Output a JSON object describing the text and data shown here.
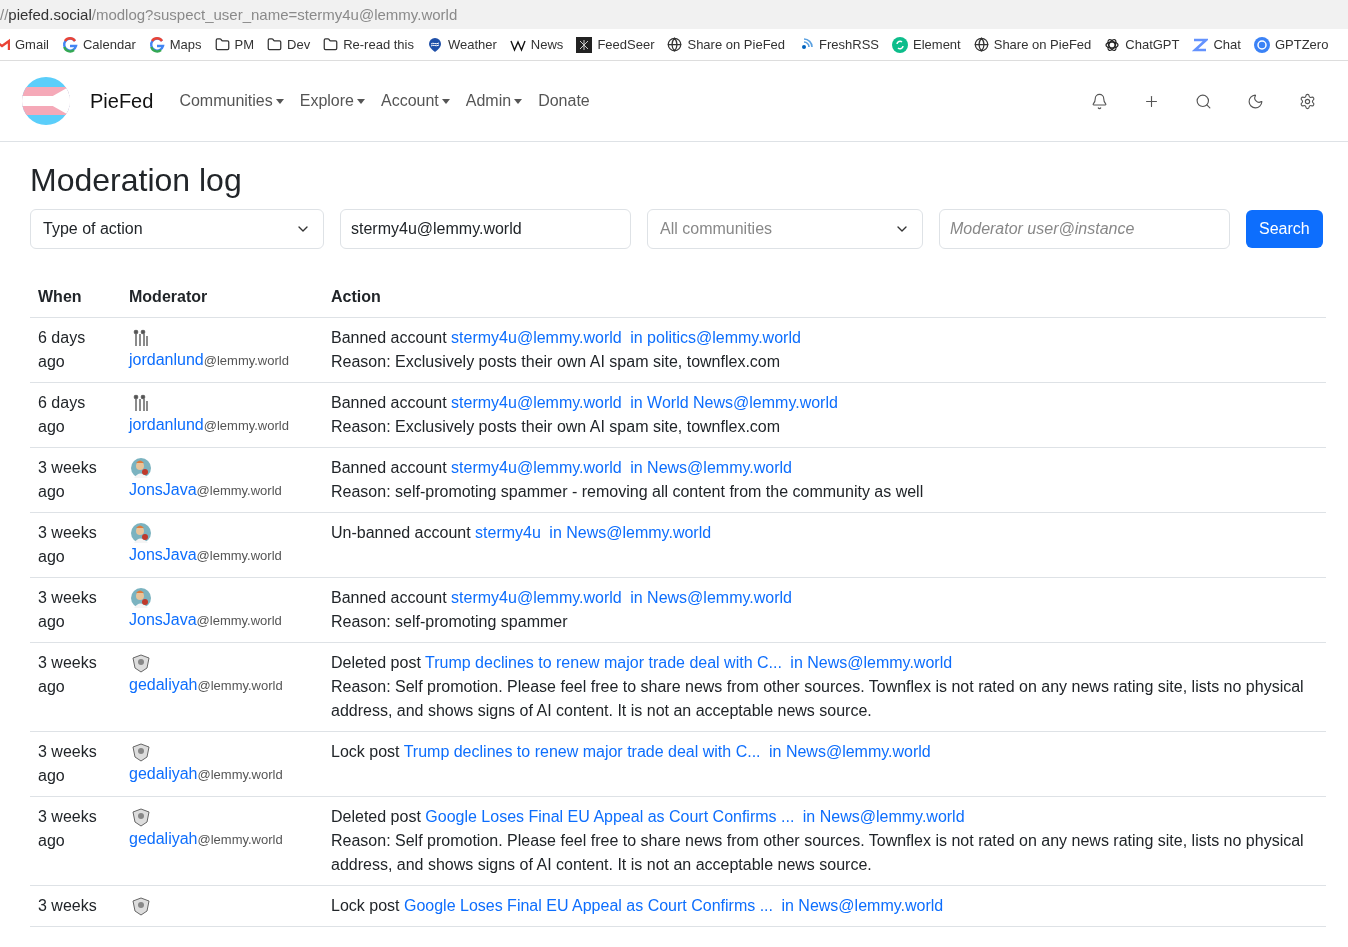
{
  "address_bar": {
    "prefix": "//",
    "host": "piefed.social",
    "path": "/modlog?suspect_user_name=stermy4u@lemmy.world"
  },
  "bookmarks": [
    {
      "label": "Gmail"
    },
    {
      "label": "Calendar"
    },
    {
      "label": "Maps"
    },
    {
      "label": "PM"
    },
    {
      "label": "Dev"
    },
    {
      "label": "Re-read this"
    },
    {
      "label": "Weather"
    },
    {
      "label": "News"
    },
    {
      "label": "FeedSeer"
    },
    {
      "label": "Share on PieFed"
    },
    {
      "label": "FreshRSS"
    },
    {
      "label": "Element"
    },
    {
      "label": "Share on PieFed"
    },
    {
      "label": "ChatGPT"
    },
    {
      "label": "Chat"
    },
    {
      "label": "GPTZero"
    }
  ],
  "navbar": {
    "brand": "PieFed",
    "menu": [
      {
        "label": "Communities",
        "dropdown": true
      },
      {
        "label": "Explore",
        "dropdown": true
      },
      {
        "label": "Account",
        "dropdown": true
      },
      {
        "label": "Admin",
        "dropdown": true
      },
      {
        "label": "Donate",
        "dropdown": false
      }
    ]
  },
  "title": "Moderation log",
  "filters": {
    "action_type": {
      "value": "Type of action"
    },
    "suspect": {
      "value": "stermy4u@lemmy.world"
    },
    "community": {
      "placeholder": "All communities"
    },
    "moderator": {
      "placeholder": "Moderator user@instance"
    },
    "button": "Search"
  },
  "table": {
    "columns": [
      "When",
      "Moderator",
      "Action"
    ],
    "rows": [
      {
        "when": "6 days ago",
        "moderator": "jordanlund",
        "instance": "@lemmy.world",
        "action": "Banned account",
        "target": "stermy4u@lemmy.world",
        "community": "in politics@lemmy.world",
        "reason": "Reason: Exclusively posts their own AI spam site, townflex.com"
      },
      {
        "when": "6 days ago",
        "moderator": "jordanlund",
        "instance": "@lemmy.world",
        "action": "Banned account",
        "target": "stermy4u@lemmy.world",
        "community": "in World News@lemmy.world",
        "reason": "Reason: Exclusively posts their own AI spam site, townflex.com"
      },
      {
        "when": "3 weeks ago",
        "moderator": "JonsJava",
        "instance": "@lemmy.world",
        "action": "Banned account",
        "target": "stermy4u@lemmy.world",
        "community": "in News@lemmy.world",
        "reason": "Reason: self-promoting spammer - removing all content from the community as well"
      },
      {
        "when": "3 weeks ago",
        "moderator": "JonsJava",
        "instance": "@lemmy.world",
        "action": "Un-banned account",
        "target": "stermy4u",
        "community": "in News@lemmy.world"
      },
      {
        "when": "3 weeks ago",
        "moderator": "JonsJava",
        "instance": "@lemmy.world",
        "action": "Banned account",
        "target": "stermy4u@lemmy.world",
        "community": "in News@lemmy.world",
        "reason": "Reason: self-promoting spammer"
      },
      {
        "when": "3 weeks ago",
        "moderator": "gedaliyah",
        "instance": "@lemmy.world",
        "action": "Deleted post",
        "target": "Trump declines to renew major trade deal with C...",
        "community": "in News@lemmy.world",
        "reason": "Reason: Self promotion. Please feel free to share news from other sources. Townflex is not rated on any news rating site, lists no physical address, and shows signs of AI content. It is not an acceptable news source."
      },
      {
        "when": "3 weeks ago",
        "moderator": "gedaliyah",
        "instance": "@lemmy.world",
        "action": "Lock post",
        "target": "Trump declines to renew major trade deal with C...",
        "community": "in News@lemmy.world"
      },
      {
        "when": "3 weeks ago",
        "moderator": "gedaliyah",
        "instance": "@lemmy.world",
        "action": "Deleted post",
        "target": "Google Loses Final EU Appeal as Court Confirms ...",
        "community": "in News@lemmy.world",
        "reason": "Reason: Self promotion. Please feel free to share news from other sources. Townflex is not rated on any news rating site, lists no physical address, and shows signs of AI content. It is not an acceptable news source."
      },
      {
        "when": "3 weeks",
        "action": "Lock post",
        "target": "Google Loses Final EU Appeal as Court Confirms ...",
        "community": "in News@lemmy.world"
      }
    ]
  }
}
